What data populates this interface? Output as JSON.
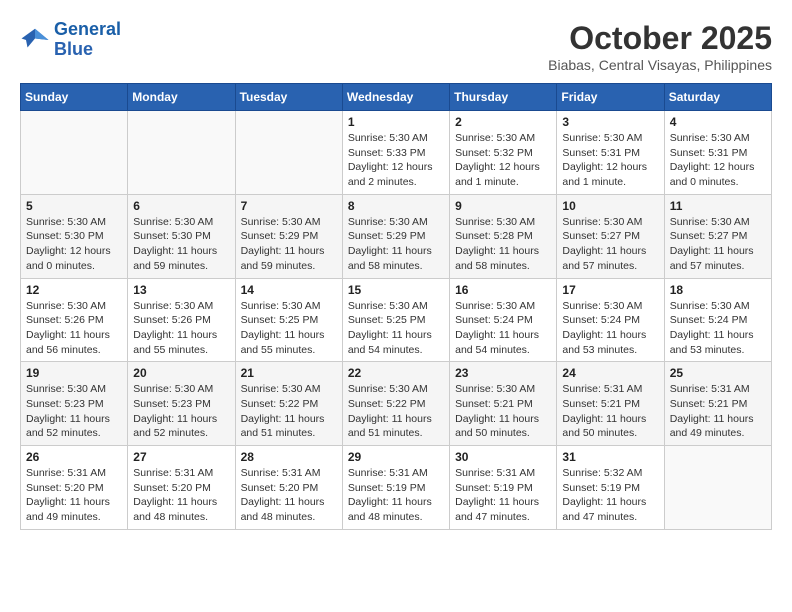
{
  "logo": {
    "line1": "General",
    "line2": "Blue"
  },
  "title": "October 2025",
  "location": "Biabas, Central Visayas, Philippines",
  "days_header": [
    "Sunday",
    "Monday",
    "Tuesday",
    "Wednesday",
    "Thursday",
    "Friday",
    "Saturday"
  ],
  "weeks": [
    [
      {
        "day": "",
        "info": ""
      },
      {
        "day": "",
        "info": ""
      },
      {
        "day": "",
        "info": ""
      },
      {
        "day": "1",
        "info": "Sunrise: 5:30 AM\nSunset: 5:33 PM\nDaylight: 12 hours and 2 minutes."
      },
      {
        "day": "2",
        "info": "Sunrise: 5:30 AM\nSunset: 5:32 PM\nDaylight: 12 hours and 1 minute."
      },
      {
        "day": "3",
        "info": "Sunrise: 5:30 AM\nSunset: 5:31 PM\nDaylight: 12 hours and 1 minute."
      },
      {
        "day": "4",
        "info": "Sunrise: 5:30 AM\nSunset: 5:31 PM\nDaylight: 12 hours and 0 minutes."
      }
    ],
    [
      {
        "day": "5",
        "info": "Sunrise: 5:30 AM\nSunset: 5:30 PM\nDaylight: 12 hours and 0 minutes."
      },
      {
        "day": "6",
        "info": "Sunrise: 5:30 AM\nSunset: 5:30 PM\nDaylight: 11 hours and 59 minutes."
      },
      {
        "day": "7",
        "info": "Sunrise: 5:30 AM\nSunset: 5:29 PM\nDaylight: 11 hours and 59 minutes."
      },
      {
        "day": "8",
        "info": "Sunrise: 5:30 AM\nSunset: 5:29 PM\nDaylight: 11 hours and 58 minutes."
      },
      {
        "day": "9",
        "info": "Sunrise: 5:30 AM\nSunset: 5:28 PM\nDaylight: 11 hours and 58 minutes."
      },
      {
        "day": "10",
        "info": "Sunrise: 5:30 AM\nSunset: 5:27 PM\nDaylight: 11 hours and 57 minutes."
      },
      {
        "day": "11",
        "info": "Sunrise: 5:30 AM\nSunset: 5:27 PM\nDaylight: 11 hours and 57 minutes."
      }
    ],
    [
      {
        "day": "12",
        "info": "Sunrise: 5:30 AM\nSunset: 5:26 PM\nDaylight: 11 hours and 56 minutes."
      },
      {
        "day": "13",
        "info": "Sunrise: 5:30 AM\nSunset: 5:26 PM\nDaylight: 11 hours and 55 minutes."
      },
      {
        "day": "14",
        "info": "Sunrise: 5:30 AM\nSunset: 5:25 PM\nDaylight: 11 hours and 55 minutes."
      },
      {
        "day": "15",
        "info": "Sunrise: 5:30 AM\nSunset: 5:25 PM\nDaylight: 11 hours and 54 minutes."
      },
      {
        "day": "16",
        "info": "Sunrise: 5:30 AM\nSunset: 5:24 PM\nDaylight: 11 hours and 54 minutes."
      },
      {
        "day": "17",
        "info": "Sunrise: 5:30 AM\nSunset: 5:24 PM\nDaylight: 11 hours and 53 minutes."
      },
      {
        "day": "18",
        "info": "Sunrise: 5:30 AM\nSunset: 5:24 PM\nDaylight: 11 hours and 53 minutes."
      }
    ],
    [
      {
        "day": "19",
        "info": "Sunrise: 5:30 AM\nSunset: 5:23 PM\nDaylight: 11 hours and 52 minutes."
      },
      {
        "day": "20",
        "info": "Sunrise: 5:30 AM\nSunset: 5:23 PM\nDaylight: 11 hours and 52 minutes."
      },
      {
        "day": "21",
        "info": "Sunrise: 5:30 AM\nSunset: 5:22 PM\nDaylight: 11 hours and 51 minutes."
      },
      {
        "day": "22",
        "info": "Sunrise: 5:30 AM\nSunset: 5:22 PM\nDaylight: 11 hours and 51 minutes."
      },
      {
        "day": "23",
        "info": "Sunrise: 5:30 AM\nSunset: 5:21 PM\nDaylight: 11 hours and 50 minutes."
      },
      {
        "day": "24",
        "info": "Sunrise: 5:31 AM\nSunset: 5:21 PM\nDaylight: 11 hours and 50 minutes."
      },
      {
        "day": "25",
        "info": "Sunrise: 5:31 AM\nSunset: 5:21 PM\nDaylight: 11 hours and 49 minutes."
      }
    ],
    [
      {
        "day": "26",
        "info": "Sunrise: 5:31 AM\nSunset: 5:20 PM\nDaylight: 11 hours and 49 minutes."
      },
      {
        "day": "27",
        "info": "Sunrise: 5:31 AM\nSunset: 5:20 PM\nDaylight: 11 hours and 48 minutes."
      },
      {
        "day": "28",
        "info": "Sunrise: 5:31 AM\nSunset: 5:20 PM\nDaylight: 11 hours and 48 minutes."
      },
      {
        "day": "29",
        "info": "Sunrise: 5:31 AM\nSunset: 5:19 PM\nDaylight: 11 hours and 48 minutes."
      },
      {
        "day": "30",
        "info": "Sunrise: 5:31 AM\nSunset: 5:19 PM\nDaylight: 11 hours and 47 minutes."
      },
      {
        "day": "31",
        "info": "Sunrise: 5:32 AM\nSunset: 5:19 PM\nDaylight: 11 hours and 47 minutes."
      },
      {
        "day": "",
        "info": ""
      }
    ]
  ]
}
